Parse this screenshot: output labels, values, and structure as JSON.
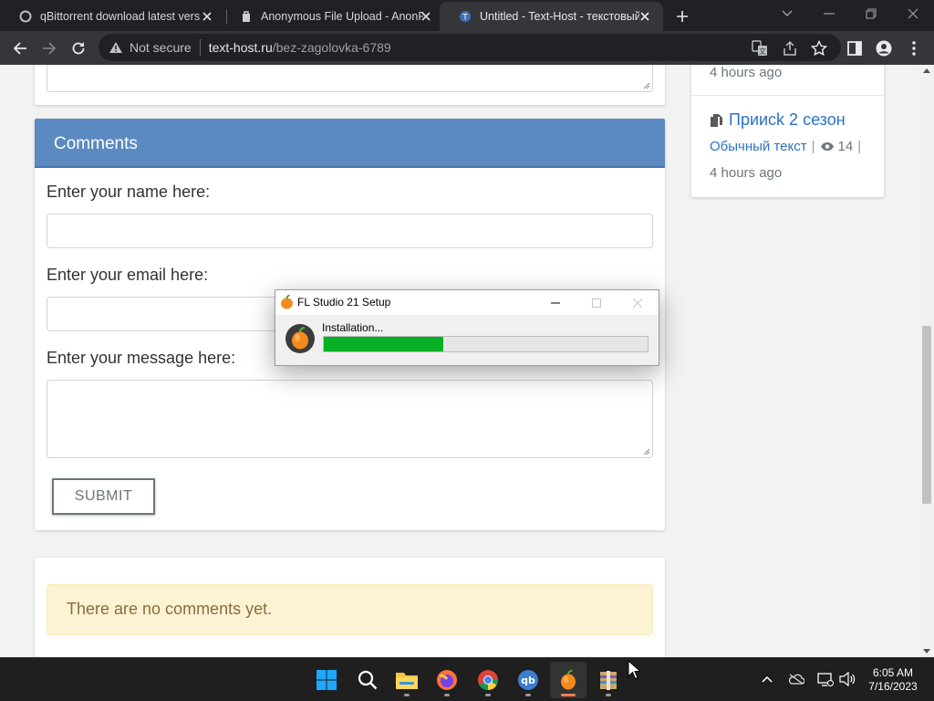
{
  "browser": {
    "tabs": [
      {
        "title": "qBittorrent download latest versi",
        "favicon": "qbittorrent-favicon",
        "active": false
      },
      {
        "title": "Anonymous File Upload - AnonF",
        "favicon": "anonfiles-favicon",
        "active": false
      },
      {
        "title": "Untitled - Text-Host - текстовый",
        "favicon": "text-host-favicon",
        "active": true
      }
    ],
    "security_label": "Not secure",
    "url_host": "text-host.ru",
    "url_path": "/bez-zagolovka-6789"
  },
  "comments": {
    "header": "Comments",
    "name_label": "Enter your name here:",
    "email_label": "Enter your email here:",
    "message_label": "Enter your message here:",
    "name_value": "",
    "email_value": "",
    "message_value": "",
    "submit_label": "SUBMIT",
    "no_comments": "There are no comments yet."
  },
  "sidebar": {
    "prev_item_time": "4 hours ago",
    "item": {
      "title": "Приисk 2 сезон",
      "category": "Обычный текст",
      "views": "14",
      "time": "4 hours ago"
    }
  },
  "installer": {
    "window_title": "FL Studio 21 Setup",
    "status": "Installation...",
    "progress_fraction": 0.37
  },
  "taskbar": {
    "apps": [
      "windows-start-icon",
      "search-icon",
      "file-explorer-icon",
      "firefox-icon",
      "chrome-icon",
      "qbittorrent-icon",
      "fl-studio-icon",
      "winrar-icon"
    ],
    "active_app": "fl-studio-icon",
    "time": "6:05 AM",
    "date": "7/16/2023"
  },
  "colors": {
    "header_blue": "#5b8ac0",
    "link_blue": "#2a72c5",
    "progress_green": "#06b025",
    "alert_bg": "#fcf3d4"
  }
}
